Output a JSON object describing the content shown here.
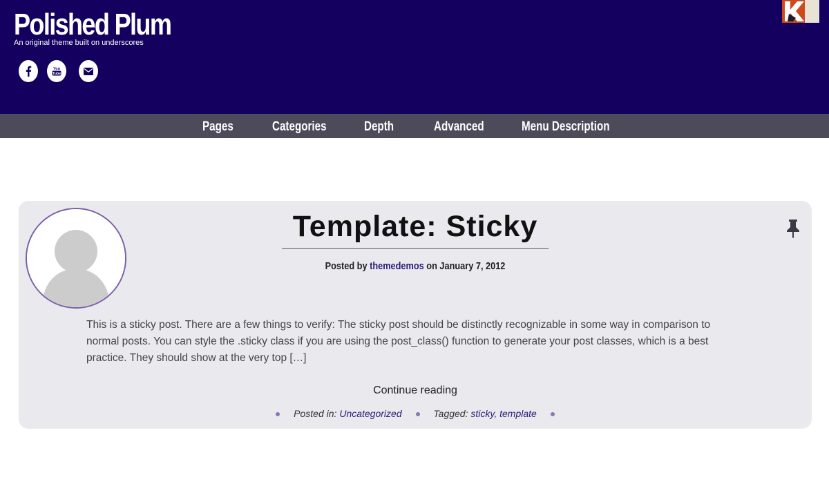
{
  "header": {
    "site_title": "Polished Plum",
    "tagline": "An original theme built on underscores",
    "social": [
      "facebook-icon",
      "youtube-icon",
      "email-icon"
    ],
    "background_color": "#13005f"
  },
  "nav": {
    "items": [
      "Pages",
      "Categories",
      "Depth",
      "Advanced",
      "Menu Description"
    ],
    "background_color": "#4d4a5a"
  },
  "post": {
    "title": "Template: Sticky",
    "byline_prefix": "Posted by",
    "author": "themedemos",
    "date_prefix": "on",
    "date": "January 7, 2012",
    "excerpt": "This is a sticky post. There are a few things to verify: The sticky post should be distinctly recognizable in some way in comparison to normal posts. You can style the .sticky class if you are using the post_class() function to generate your post classes, which is a best practice. They should show at the very top […]",
    "continue_label": "Continue reading",
    "posted_in_label": "Posted in:",
    "category": "Uncategorized",
    "tagged_label": "Tagged:",
    "tags": [
      "sticky",
      "template"
    ],
    "card_color": "#e9e9ee",
    "accent_color": "#7b5ea8",
    "sticky_icon": "pin-icon"
  }
}
